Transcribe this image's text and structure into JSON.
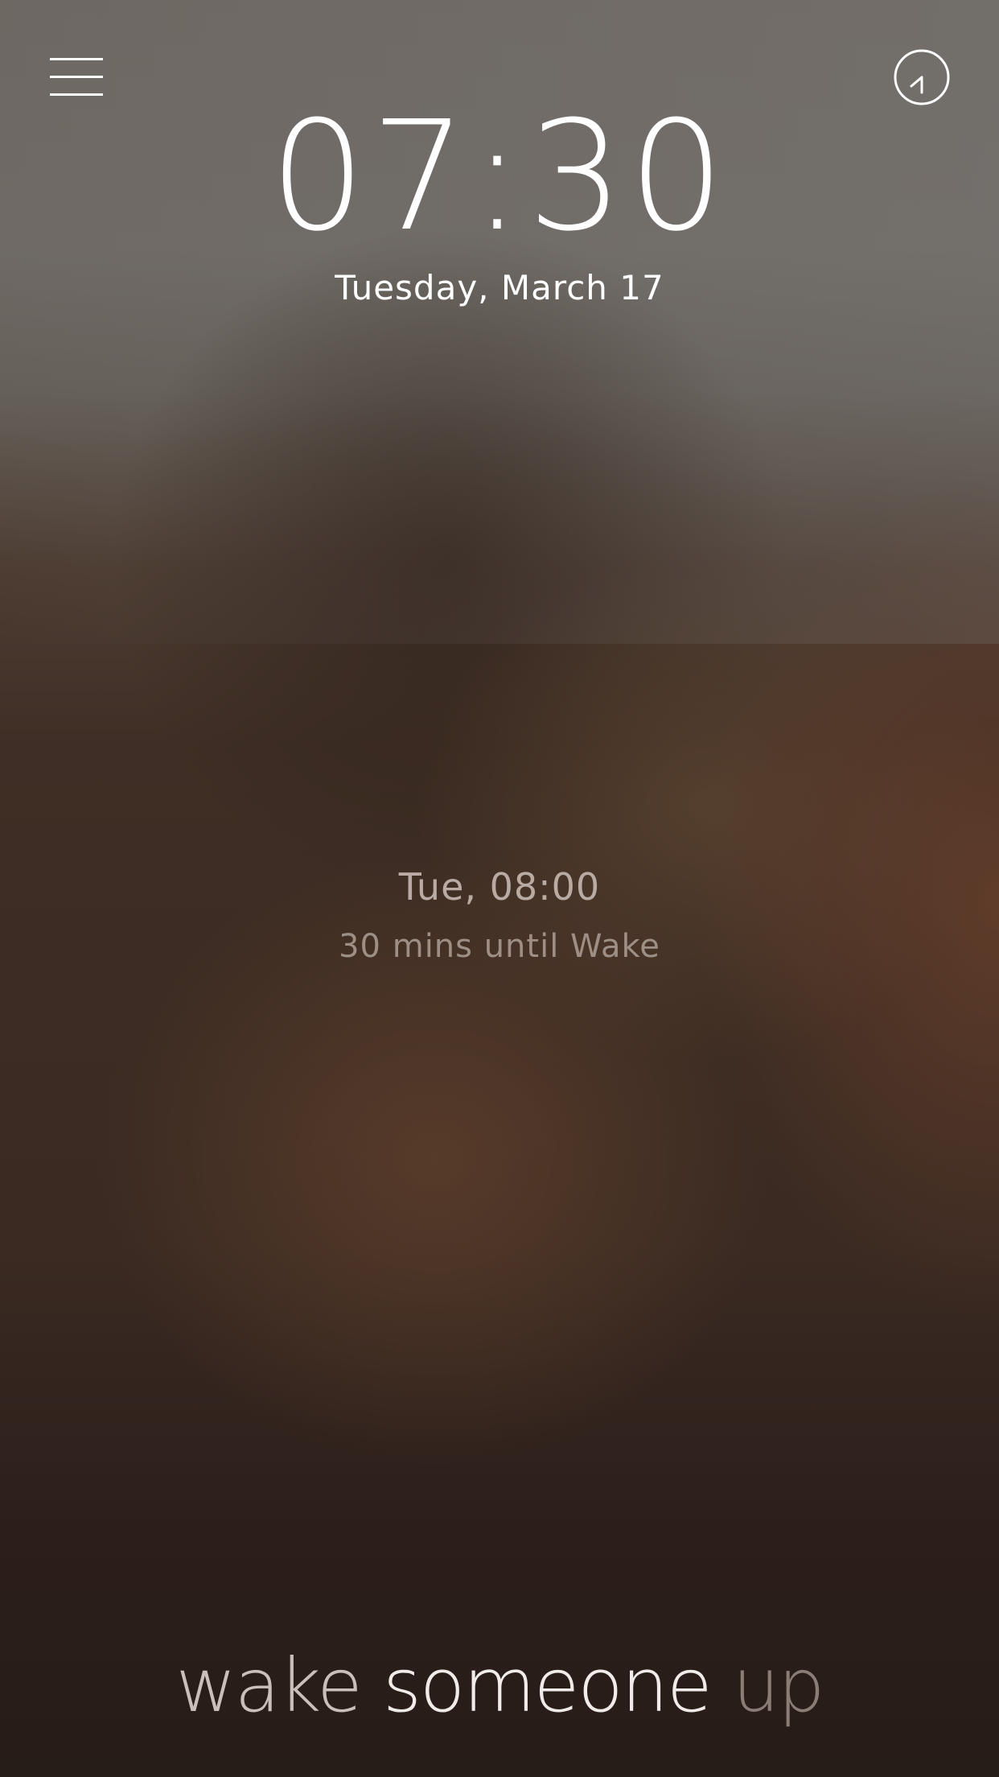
{
  "header": {
    "menu_icon": "hamburger-menu-icon",
    "clock_icon": "clock-icon"
  },
  "clock": {
    "hours": "07",
    "separator": ":",
    "minutes": "30",
    "date": "Tuesday, March 17"
  },
  "alarm": {
    "next": "Tue, 08:00",
    "countdown": "30 mins until Wake"
  },
  "tagline": {
    "word1": "wake",
    "word2": "someone",
    "word3": "up"
  },
  "colors": {
    "text_primary": "#ffffff",
    "text_muted": "#b9aba3",
    "background_top": "#6e6863",
    "background_bottom": "#261c18"
  }
}
